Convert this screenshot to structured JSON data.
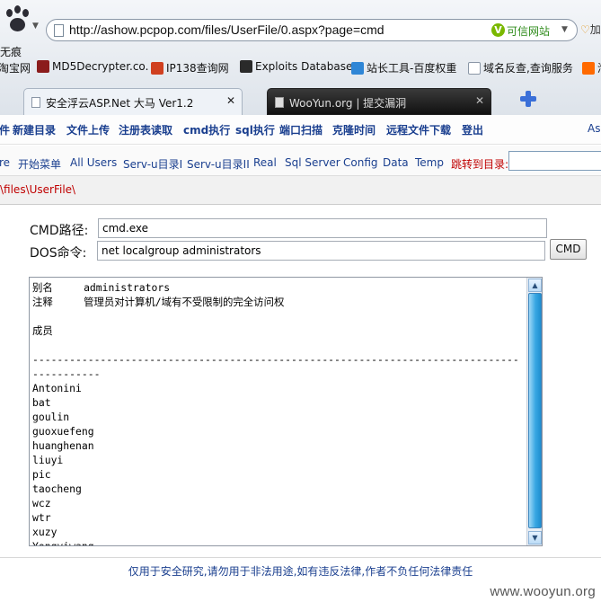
{
  "browser": {
    "address_url": "http://ashow.pcpop.com/files/UserFile/0.aspx?page=cmd",
    "trust_label": "可信网站",
    "right_edge_text": "加",
    "side_text": "无痕",
    "bookmarks": [
      {
        "label": "淘宝网",
        "icon": "taobao-icon",
        "color": "#ff6a00"
      },
      {
        "label": "MD5Decrypter.co.",
        "icon": "md5-icon",
        "color": "#8b1c1c"
      },
      {
        "label": "IP138查询网",
        "icon": "ip138-icon",
        "color": "#d04020"
      },
      {
        "label": "Exploits Database",
        "icon": "exploitdb-icon",
        "color": "#2a2a2a"
      },
      {
        "label": "站长工具-百度权重",
        "icon": "chinaz-icon",
        "color": "#2f86d6"
      },
      {
        "label": "域名反查,查询服务",
        "icon": "page-icon",
        "color": "#ffffff"
      },
      {
        "label": "淘",
        "icon": "taobao-icon",
        "color": "#ff6a00"
      }
    ],
    "tabs": [
      {
        "label": "安全浮云ASP.Net 大马 Ver1.2",
        "active": true
      },
      {
        "label": "WooYun.org | 提交漏洞",
        "active": false
      }
    ]
  },
  "menu1": [
    "件",
    "新建目录",
    "文件上传",
    "注册表读取",
    "cmd执行",
    "sql执行",
    "端口扫描",
    "克隆时间",
    "远程文件下载",
    "登出",
    "As"
  ],
  "menu2": [
    "re",
    "开始菜单",
    "All Users",
    "Serv-u目录I",
    "Serv-u目录II",
    "Real",
    "Sql Server",
    "Config",
    "Data",
    "Temp"
  ],
  "jump_label": "跳转到目录:",
  "current_path": "\\files\\UserFile\\",
  "form": {
    "cmd_path_label": "CMD路径:",
    "cmd_path_value": "cmd.exe",
    "dos_cmd_label": "DOS命令:",
    "dos_cmd_value": "net localgroup administrators",
    "button_label": "CMD"
  },
  "output_text": "别名     administrators\n注释     管理员对计算机/域有不受限制的完全访问权\n\n成员\n\n-------------------------------------------------------------------------------\n-----------\nAntonini\nbat\ngoulin\nguoxuefeng\nhuanghenan\nliuyi\npic\ntaocheng\nwcz\nwtr\nxuzy\nYongyiwang",
  "footer": "仅用于安全研究,请勿用于非法用途,如有违反法律,作者不负任何法律责任",
  "watermark": "www.wooyun.org"
}
